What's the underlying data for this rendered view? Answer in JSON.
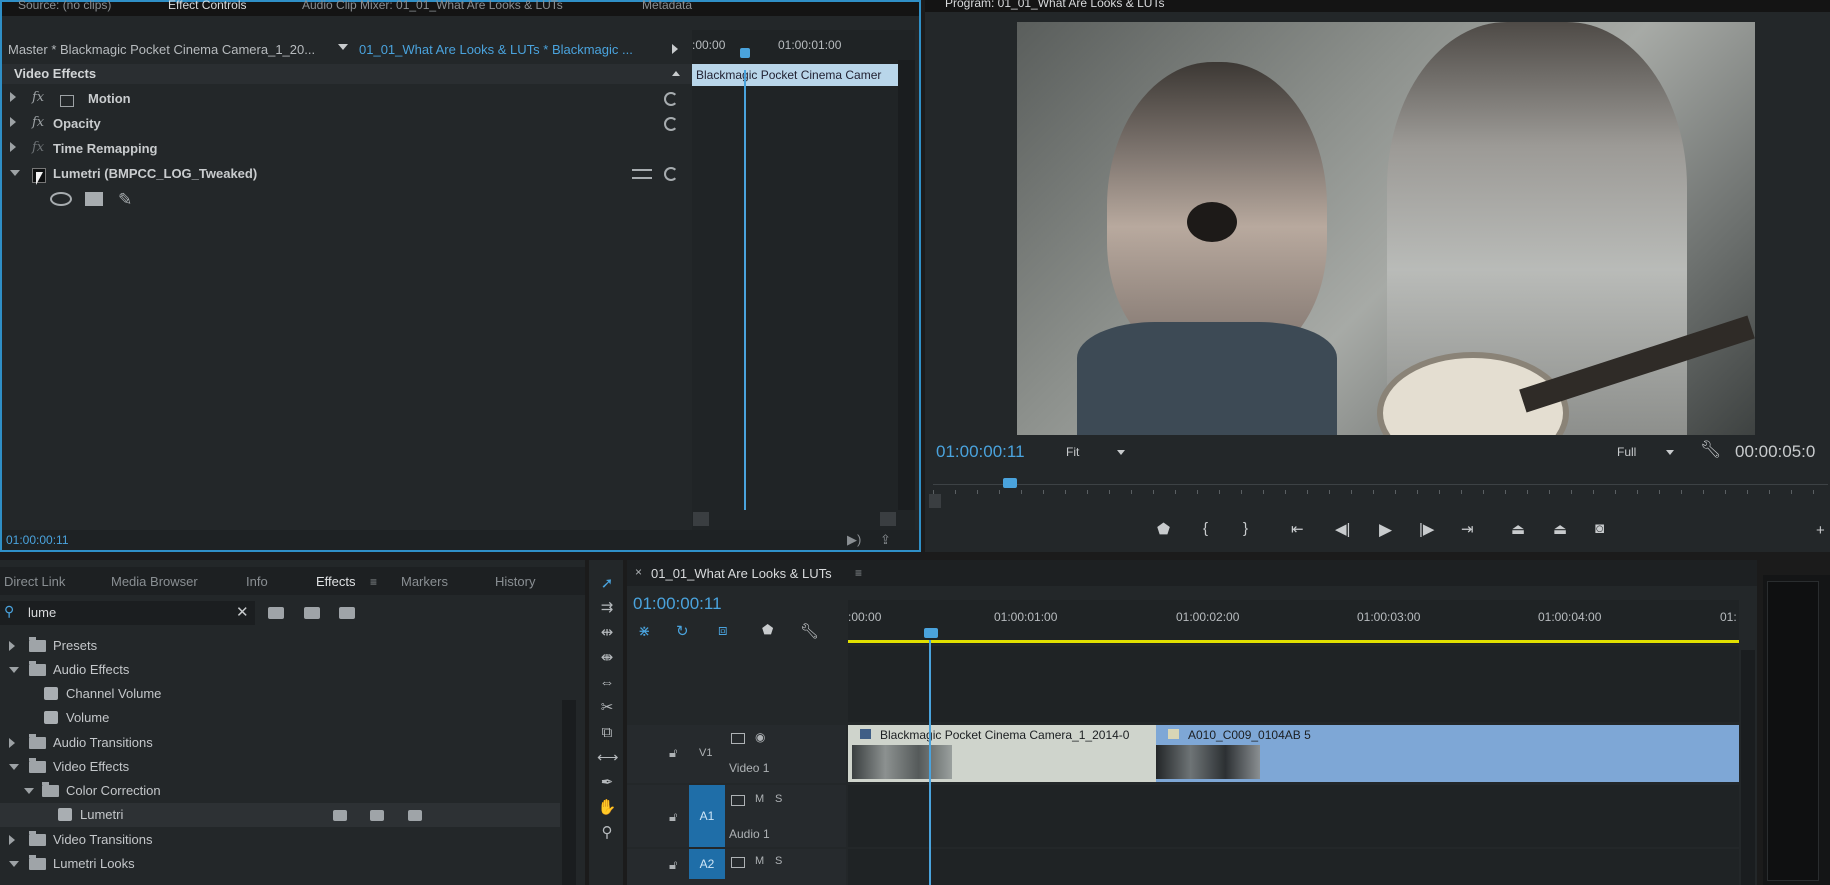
{
  "effect_controls": {
    "tabs": [
      "Source: (no clips)",
      "Effect Controls",
      "Audio Clip Mixer: 01_01_What Are Looks & LUTs",
      "Metadata"
    ],
    "master_label": "Master * Blackmagic Pocket Cinema Camera_1_20...",
    "sequence_label": "01_01_What Are Looks & LUTs * Blackmagic ...",
    "ruler": {
      "start": ":00:00",
      "mark": "01:00:01:00"
    },
    "clip_label": "Blackmagic Pocket Cinema Camer",
    "section_title": "Video Effects",
    "effects": [
      {
        "label": "Motion",
        "open": false
      },
      {
        "label": "Opacity",
        "open": false
      },
      {
        "label": "Time Remapping",
        "open": false
      },
      {
        "label": "Lumetri (BMPCC_LOG_Tweaked)",
        "open": true
      }
    ],
    "fx_symbol": "fx",
    "current_time": "01:00:00:11"
  },
  "program_monitor": {
    "tab": "Program: 01_01_What Are Looks & LUTs",
    "timecode": "01:00:00:11",
    "zoom": "Fit",
    "quality": "Full",
    "duration": "00:00:05:0"
  },
  "effects_panel": {
    "tabs": [
      "Direct Link",
      "Media Browser",
      "Info",
      "Effects",
      "Markers",
      "History"
    ],
    "active_tab": "Effects",
    "search_value": "lume",
    "tree": [
      {
        "label": "Presets",
        "level": 0,
        "kind": "folder",
        "open": false
      },
      {
        "label": "Audio Effects",
        "level": 0,
        "kind": "folder",
        "open": true
      },
      {
        "label": "Channel Volume",
        "level": 1,
        "kind": "effect"
      },
      {
        "label": "Volume",
        "level": 1,
        "kind": "effect"
      },
      {
        "label": "Audio Transitions",
        "level": 0,
        "kind": "folder",
        "open": false
      },
      {
        "label": "Video Effects",
        "level": 0,
        "kind": "folder",
        "open": true
      },
      {
        "label": "Color Correction",
        "level": 1,
        "kind": "folder",
        "open": true
      },
      {
        "label": "Lumetri",
        "level": 2,
        "kind": "effect",
        "selected": true
      },
      {
        "label": "Video Transitions",
        "level": 0,
        "kind": "folder",
        "open": false
      },
      {
        "label": "Lumetri Looks",
        "level": 0,
        "kind": "folder",
        "open": true
      }
    ]
  },
  "timeline": {
    "tab": "01_01_What Are Looks & LUTs",
    "timecode": "01:00:00:11",
    "ruler": [
      ":00:00",
      "01:00:01:00",
      "01:00:02:00",
      "01:00:03:00",
      "01:00:04:00",
      "01:"
    ],
    "tracks": {
      "v1": {
        "target": "V1",
        "name": "Video 1"
      },
      "a1": {
        "target": "A1",
        "name": "Audio 1",
        "m": "M",
        "s": "S"
      },
      "a2": {
        "target": "A2",
        "m": "M",
        "s": "S"
      }
    },
    "clips": [
      {
        "label": "Blackmagic Pocket Cinema Camera_1_2014-0"
      },
      {
        "label": "A010_C009_0104AB 5"
      }
    ]
  },
  "colors": {
    "accent": "#4aa3dd",
    "clip_video": "#7ea7d6",
    "workarea": "#e1e000"
  }
}
